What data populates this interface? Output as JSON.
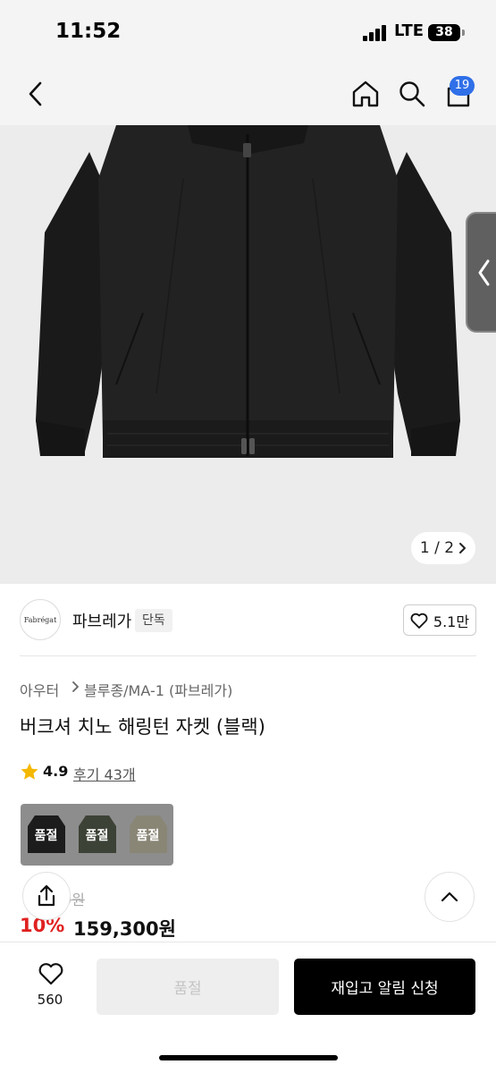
{
  "status_bar": {
    "time": "11:52",
    "network": "LTE",
    "battery": "38"
  },
  "header": {
    "back_icon": "chevron-left-icon",
    "home_icon": "home-icon",
    "search_icon": "search-icon",
    "cart_icon": "cart-icon",
    "cart_count": "19"
  },
  "gallery": {
    "page_counter": "1 / 2",
    "description_icon": "jacket-image"
  },
  "brand": {
    "logo_text": "Fabrégat",
    "name": "파브레가",
    "badge": "단독",
    "likes": "5.1만"
  },
  "product": {
    "category_parent": "아우터",
    "category_child": "블루종/MA-1 (파브레가)",
    "title": "버크셔 치노 해링턴 자켓 (블랙)",
    "rating": "4.9",
    "reviews": "후기 43개",
    "options": [
      {
        "label": "품절",
        "color": "#1c1c1c"
      },
      {
        "label": "품절",
        "color": "#3d4236"
      },
      {
        "label": "품절",
        "color": "#8a8676"
      }
    ],
    "original_price": "9원",
    "discount": "10%",
    "sale_price": "159,300원"
  },
  "bottom_bar": {
    "wish_count": "560",
    "soldout_label": "품절",
    "restock_label": "재입고 알림 신청"
  },
  "colors": {
    "accent_blue": "#2f6fe8",
    "discount_red": "#e02020",
    "star_yellow": "#f5b800"
  }
}
